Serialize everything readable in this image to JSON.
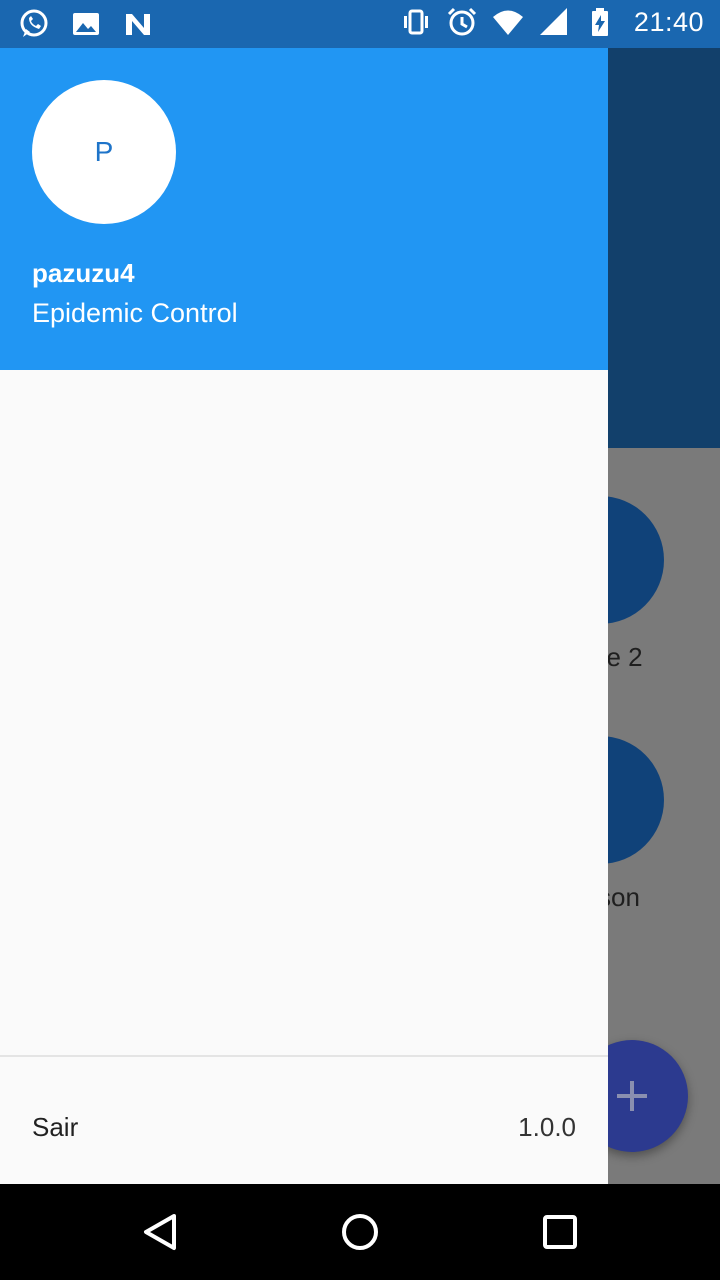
{
  "status_bar": {
    "time": "21:40",
    "left_icons": [
      "whatsapp-icon",
      "image-icon",
      "n-icon"
    ],
    "right_icons": [
      "vibrate-icon",
      "alarm-icon",
      "wifi-icon",
      "signal-icon",
      "battery-charging-icon"
    ]
  },
  "drawer": {
    "avatar_initial": "P",
    "username": "pazuzu4",
    "subtitle": "Epidemic Control",
    "logout_label": "Sair",
    "version": "1.0.0"
  },
  "background_app": {
    "item_labels": [
      "ue 2",
      "son"
    ],
    "fab_icon": "plus-icon"
  },
  "nav_bar": {
    "buttons": [
      "back-icon",
      "home-icon",
      "recents-icon"
    ]
  },
  "colors": {
    "drawer_header": "#2196f3",
    "status_bar": "#1a67b0",
    "drawer_background": "#fafafa"
  }
}
